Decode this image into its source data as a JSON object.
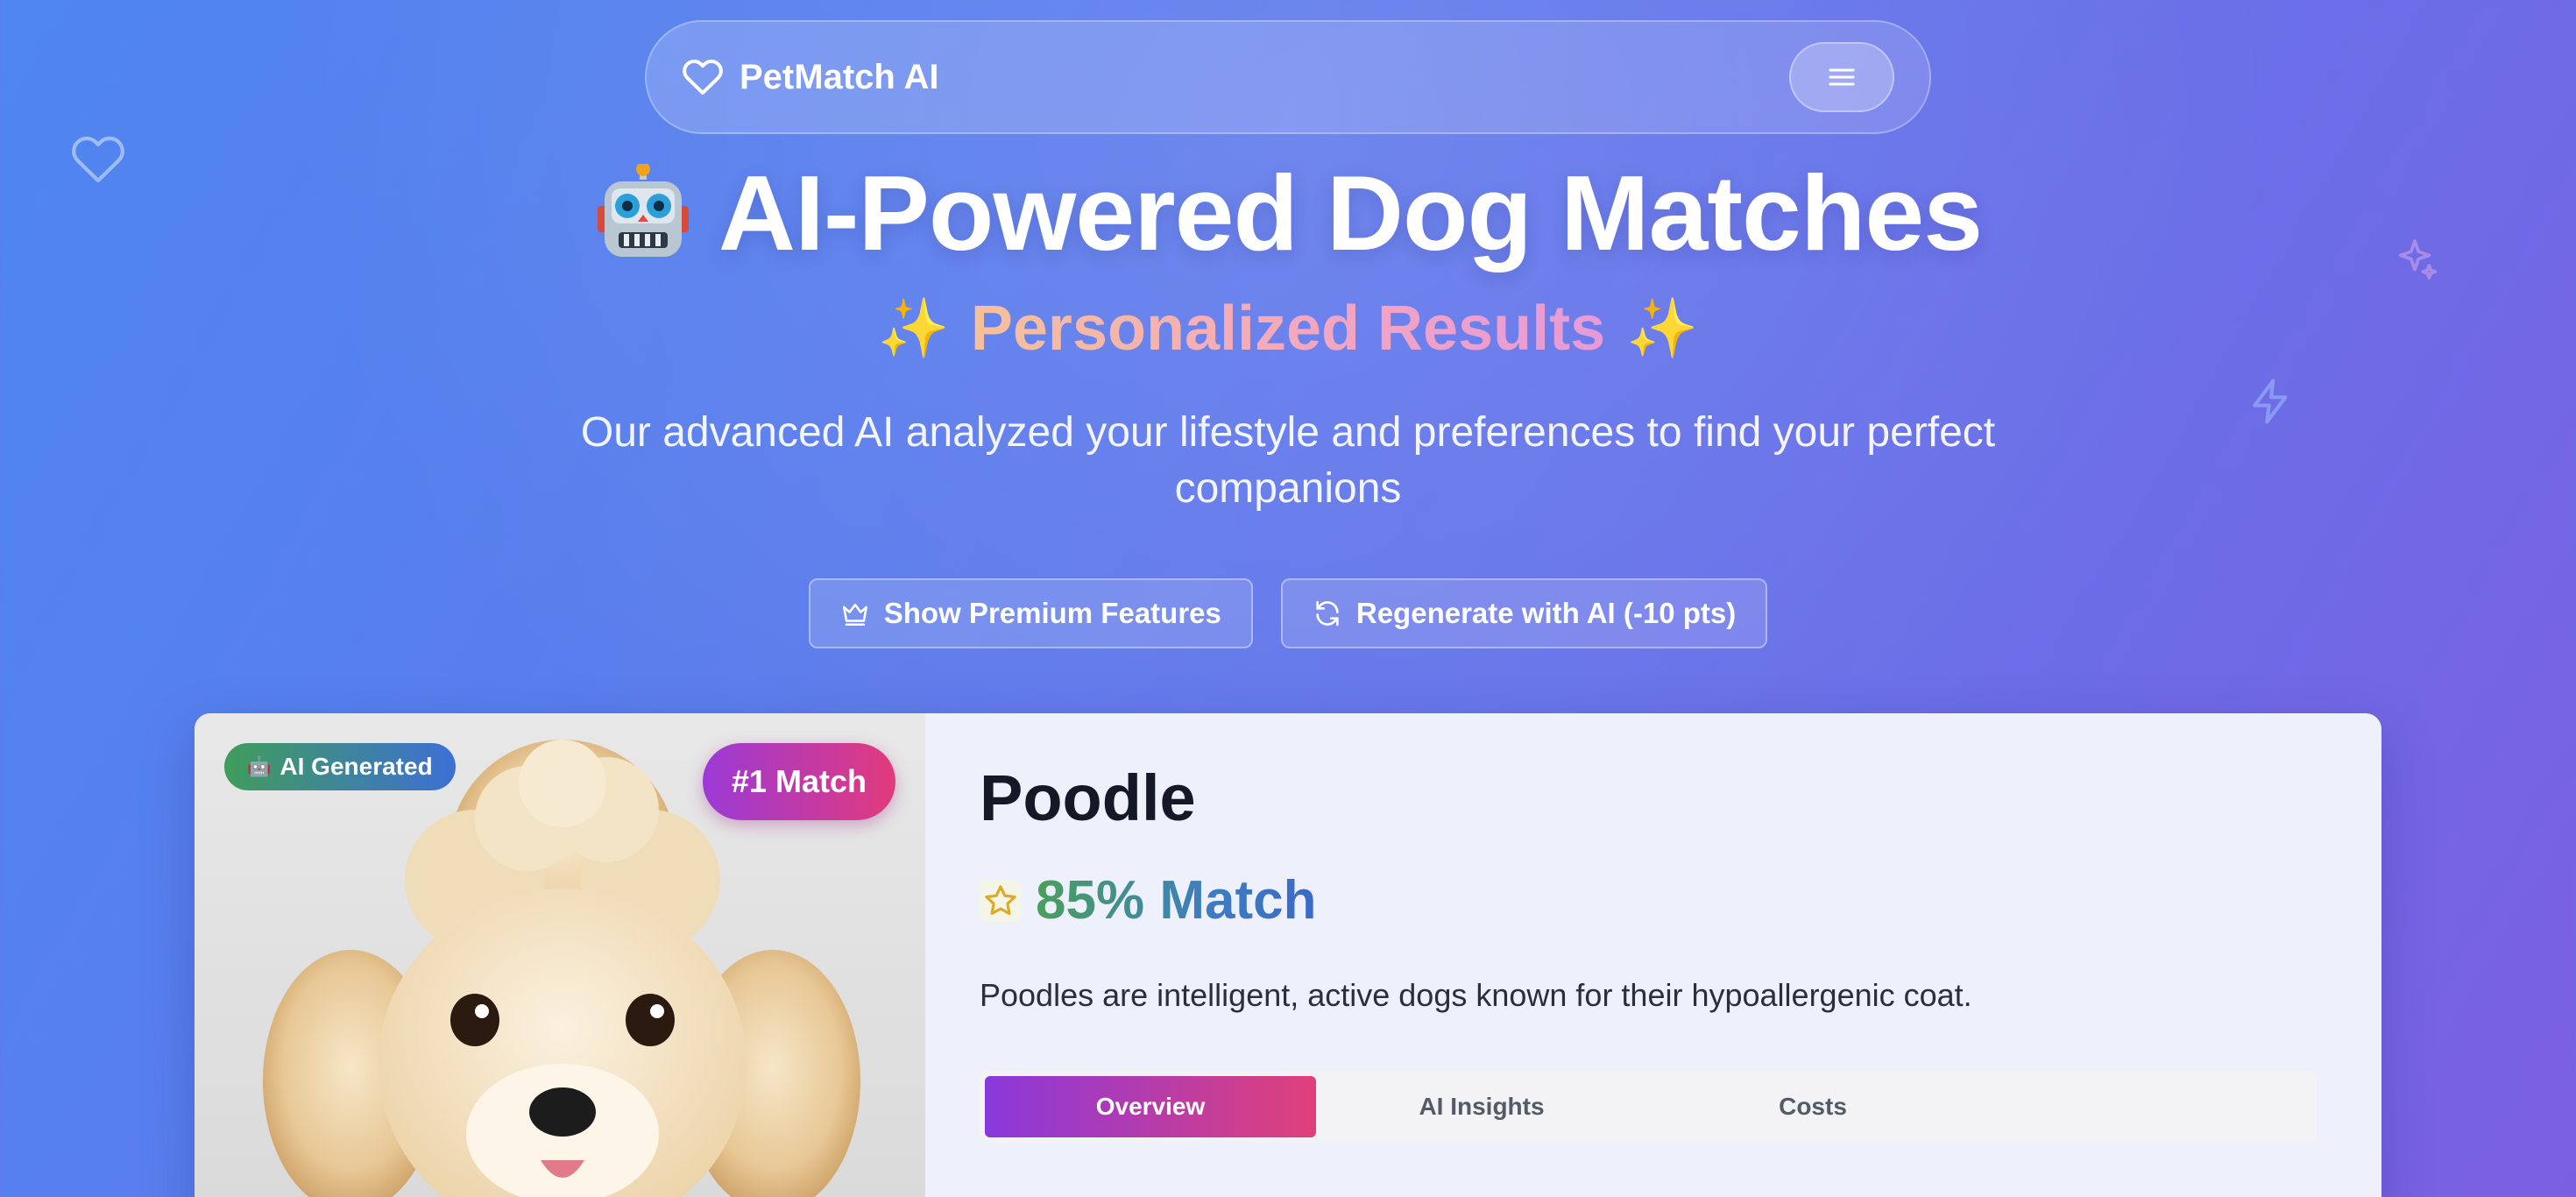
{
  "nav": {
    "brand_name": "PetMatch AI",
    "brand_icon": "heart-icon",
    "menu_icon": "menu-icon"
  },
  "hero": {
    "title_emoji": "🤖",
    "title": "AI-Powered Dog Matches",
    "subtitle_prefix": "✨",
    "subtitle": "Personalized Results",
    "subtitle_suffix": "✨",
    "description": "Our advanced AI analyzed your lifestyle and preferences to find your perfect companions",
    "actions": [
      {
        "label": "Show Premium Features",
        "icon": "crown-icon"
      },
      {
        "label": "Regenerate with AI (-10 pts)",
        "icon": "refresh-icon"
      }
    ]
  },
  "match_card": {
    "ai_badge_emoji": "🤖",
    "ai_badge": "AI Generated",
    "rank_badge": "#1 Match",
    "breed": "Poodle",
    "match_percent": "85% Match",
    "match_icon": "star-icon",
    "description": "Poodles are intelligent, active dogs known for their hypoallergenic coat.",
    "tabs": [
      {
        "label": "Overview",
        "active": true
      },
      {
        "label": "AI Insights",
        "active": false
      },
      {
        "label": "Costs",
        "active": false
      }
    ]
  },
  "colors": {
    "background_start": "#4f86f0",
    "background_end": "#7b5fe2",
    "rank_badge_start": "#9b3ad6",
    "rank_badge_end": "#e23a7c",
    "match_green": "#4aa05a",
    "match_blue": "#3a6ac8"
  }
}
